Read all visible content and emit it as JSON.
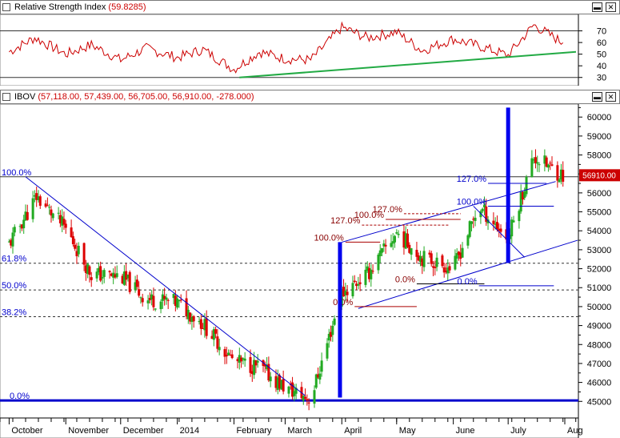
{
  "rsi_panel": {
    "title": "Relative Strength Index",
    "value": "(59.8285)",
    "axis_ticks": [
      "70",
      "60",
      "50",
      "40",
      "30"
    ]
  },
  "price_panel": {
    "title": "IBOV",
    "ohlc": "(57,118.00, 57,439.00, 56,705.00, 56,910.00, -278.000)",
    "last_price_label": "56910.00",
    "y_ticks": [
      "60000",
      "59000",
      "58000",
      "57000",
      "56000",
      "55000",
      "54000",
      "53000",
      "52000",
      "51000",
      "50000",
      "49000",
      "48000",
      "47000",
      "46000",
      "45000"
    ],
    "x_ticks": [
      "October",
      "November",
      "December",
      "2014",
      "February",
      "March",
      "April",
      "May",
      "June",
      "July",
      "Aug"
    ],
    "fib_main": [
      "100.0%",
      "61.8%",
      "50.0%",
      "38.2%",
      "0.0%"
    ],
    "fib_minor": [
      "100.0%",
      "127.0%",
      "0.0%",
      "127.0%",
      "100.0%",
      "0.0%",
      "127.0%",
      "100.0%",
      "0.0%"
    ]
  },
  "colors": {
    "up": "#22aa22",
    "down": "#dd0000",
    "rsi_line": "#cc0000",
    "trend": "#22aa44",
    "channel": "#0000cc",
    "volume_bar": "#0000ee"
  },
  "chart_data": [
    {
      "type": "line",
      "title": "Relative Strength Index",
      "ylim": [
        25,
        80
      ],
      "y_ticks": [
        70,
        60,
        50,
        40,
        30
      ],
      "reference_lines": [
        70,
        30
      ],
      "series": [
        {
          "name": "Relative Strength Index",
          "x": [
            "2013-10-01",
            "2013-10-15",
            "2013-11-01",
            "2013-11-15",
            "2013-12-01",
            "2013-12-15",
            "2014-01-01",
            "2014-01-15",
            "2014-02-01",
            "2014-02-15",
            "2014-03-01",
            "2014-03-15",
            "2014-04-01",
            "2014-04-15",
            "2014-05-01",
            "2014-05-15",
            "2014-06-01",
            "2014-06-15",
            "2014-07-01",
            "2014-07-15",
            "2014-07-31"
          ],
          "values": [
            52,
            64,
            50,
            58,
            45,
            55,
            47,
            54,
            37,
            52,
            46,
            45,
            73,
            64,
            69,
            53,
            63,
            57,
            49,
            75,
            59.8
          ]
        }
      ]
    },
    {
      "type": "candlestick",
      "title": "IBOV",
      "ylim": [
        44800,
        60600
      ],
      "y_ticks": [
        45000,
        46000,
        47000,
        48000,
        49000,
        50000,
        51000,
        52000,
        53000,
        54000,
        55000,
        56000,
        57000,
        58000,
        59000,
        60000
      ],
      "x_ticks": [
        "October",
        "November",
        "December",
        "2014",
        "February",
        "March",
        "April",
        "May",
        "June",
        "July",
        "Aug"
      ],
      "last": 56910,
      "path_dates": [
        "2013-10-01",
        "2013-10-16",
        "2013-11-01",
        "2013-11-15",
        "2013-12-01",
        "2013-12-15",
        "2014-01-01",
        "2014-01-15",
        "2014-02-01",
        "2014-02-15",
        "2014-03-01",
        "2014-03-15",
        "2014-04-01",
        "2014-04-15",
        "2014-05-01",
        "2014-05-15",
        "2014-06-01",
        "2014-06-15",
        "2014-07-01",
        "2014-07-15",
        "2014-07-31"
      ],
      "path_closes": [
        53300,
        55800,
        54100,
        51700,
        51600,
        50400,
        50200,
        49100,
        47100,
        46800,
        45700,
        45100,
        50700,
        51700,
        53900,
        52600,
        52000,
        55300,
        53600,
        57900,
        56910
      ],
      "fibonacci_main": [
        {
          "label": "100.0%",
          "value": 56850
        },
        {
          "label": "61.8%",
          "value": 52290
        },
        {
          "label": "50.0%",
          "value": 50880
        },
        {
          "label": "38.2%",
          "value": 49470
        },
        {
          "label": "0.0%",
          "value": 45050
        }
      ],
      "fibonacci_minor": [
        {
          "label": "100.0%",
          "value": 53400
        },
        {
          "label": "127.0%",
          "value": 54300
        },
        {
          "label": "0.0%",
          "value": 50000
        },
        {
          "label": "127.0%",
          "value": 54900
        },
        {
          "label": "100.0%",
          "value": 54600
        },
        {
          "label": "0.0%",
          "value": 51200
        },
        {
          "label": "127.0%",
          "value": 56500
        },
        {
          "label": "100.0%",
          "value": 55300
        },
        {
          "label": "0.0%",
          "value": 51100
        }
      ],
      "volume_spikes": [
        {
          "date": "2014-03-31",
          "from": 45200,
          "to": 53400
        },
        {
          "date": "2014-07-01",
          "from": 52300,
          "to": 60500
        }
      ]
    }
  ]
}
